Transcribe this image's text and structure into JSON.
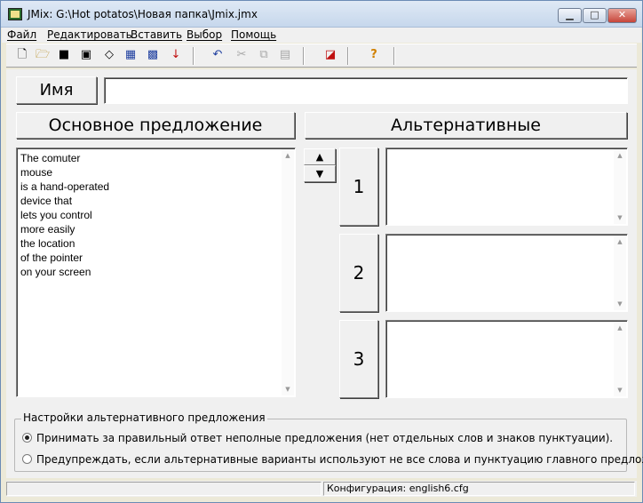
{
  "window": {
    "title": "JMix: G:\\Hot potatos\\Новая папка\\Jmix.jmx",
    "minimize_icon": "minimize-icon",
    "maximize_icon": "maximize-icon",
    "close_icon": "close-icon"
  },
  "menu": {
    "items": [
      {
        "label": "Файл"
      },
      {
        "label": "Редактировать"
      },
      {
        "label": "Вставить"
      },
      {
        "label": "Выбор"
      },
      {
        "label": "Помощь"
      }
    ]
  },
  "toolbar": {
    "icons": [
      "new-file-icon",
      "open-folder-icon",
      "save-icon",
      "save-as-icon",
      "eraser-icon",
      "export-web-icon",
      "export-drag-icon",
      "download-arrow-icon",
      "undo-icon",
      "cut-icon",
      "copy-icon",
      "paste-icon",
      "config-icon",
      "help-icon"
    ]
  },
  "name": {
    "label": "Имя",
    "value": ""
  },
  "headers": {
    "main": "Основное предложение",
    "alternatives": "Альтернативные"
  },
  "main_sentence": {
    "lines": [
      "The comuter",
      "mouse",
      "is a hand-operated",
      "device that",
      "lets you control",
      "more easily",
      "the location",
      "of the pointer",
      "on your screen"
    ]
  },
  "alternatives": [
    {
      "number": "1",
      "text": ""
    },
    {
      "number": "2",
      "text": ""
    },
    {
      "number": "3",
      "text": ""
    }
  ],
  "settings": {
    "title": "Настройки альтернативного предложения",
    "options": [
      {
        "label": "Принимать за правильный ответ неполные предложения (нет отдельных слов и знаков пунктуации).",
        "selected": true
      },
      {
        "label": "Предупреждать, если альтернативные варианты используют не все слова и пунктуацию главного предложени",
        "selected": false
      }
    ]
  },
  "status": {
    "config": "Конфигурация: english6.cfg"
  },
  "colors": {
    "window_bg": "#f0f0f0",
    "title_gradient": "#c6d7ec",
    "close_red": "#c7453a"
  }
}
